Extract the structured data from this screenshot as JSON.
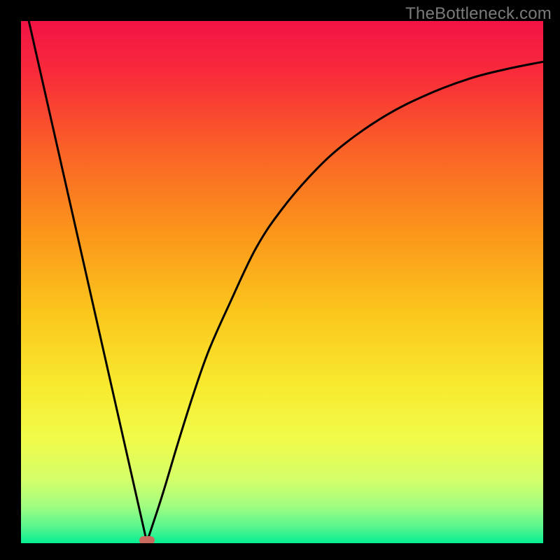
{
  "watermark": "TheBottleneck.com",
  "chart_data": {
    "type": "line",
    "title": "",
    "xlabel": "",
    "ylabel": "",
    "x_range": [
      0,
      1
    ],
    "y_range": [
      0,
      1
    ],
    "gradient_stops": [
      {
        "offset": 0.0,
        "color": "#f31346"
      },
      {
        "offset": 0.1,
        "color": "#f82b3a"
      },
      {
        "offset": 0.25,
        "color": "#fa6327"
      },
      {
        "offset": 0.4,
        "color": "#fb941b"
      },
      {
        "offset": 0.55,
        "color": "#fbc41c"
      },
      {
        "offset": 0.7,
        "color": "#f8ea2f"
      },
      {
        "offset": 0.8,
        "color": "#f0fb4a"
      },
      {
        "offset": 0.88,
        "color": "#d3fe6a"
      },
      {
        "offset": 0.93,
        "color": "#a0fd80"
      },
      {
        "offset": 0.97,
        "color": "#55f58f"
      },
      {
        "offset": 1.0,
        "color": "#06ee93"
      }
    ],
    "series": [
      {
        "name": "left-line",
        "x": [
          0.015,
          0.241
        ],
        "y": [
          1.0,
          0.002
        ]
      },
      {
        "name": "right-curve",
        "x": [
          0.241,
          0.27,
          0.3,
          0.33,
          0.36,
          0.4,
          0.45,
          0.5,
          0.56,
          0.62,
          0.7,
          0.78,
          0.86,
          0.93,
          1.0
        ],
        "y": [
          0.002,
          0.09,
          0.19,
          0.285,
          0.37,
          0.46,
          0.565,
          0.64,
          0.71,
          0.765,
          0.82,
          0.86,
          0.89,
          0.908,
          0.922
        ]
      }
    ],
    "marker": {
      "x": 0.241,
      "y": 0.006,
      "color": "#c66b5e"
    }
  }
}
